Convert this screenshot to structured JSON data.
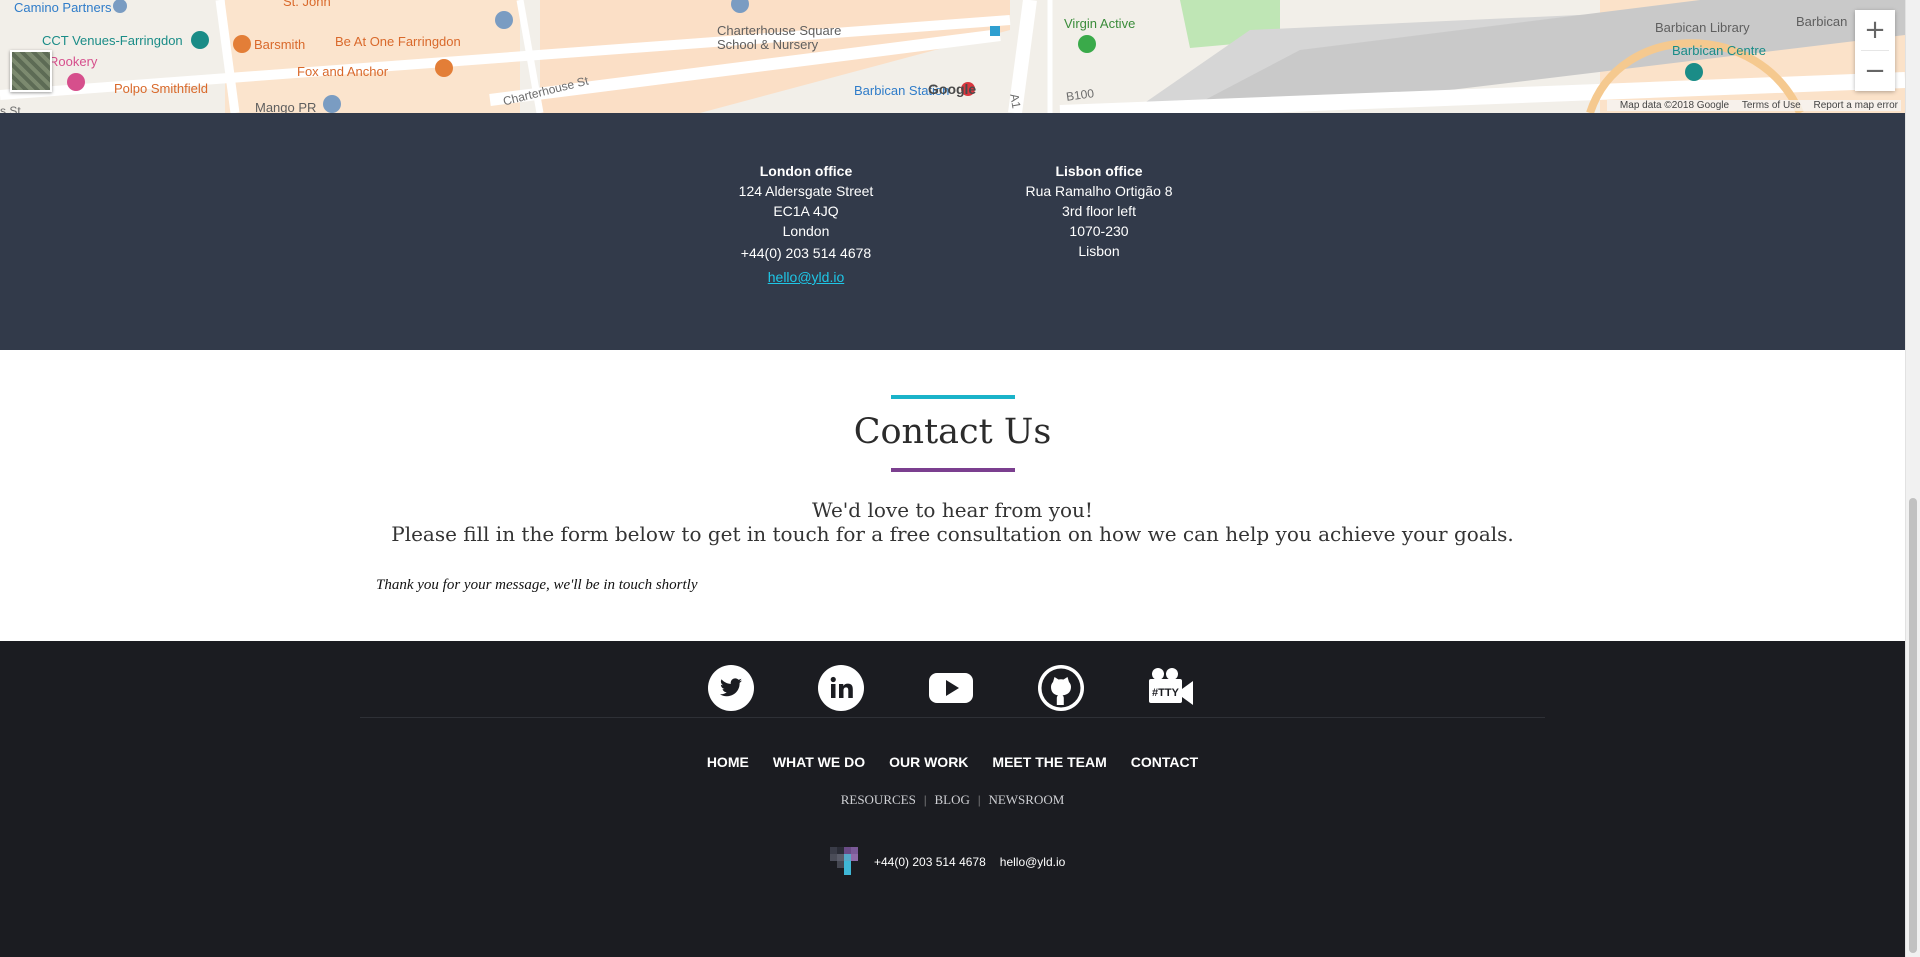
{
  "map": {
    "labels": {
      "camino": "Camino Partners",
      "cct": "CCT Venues-Farringdon",
      "rookery": "Rookery",
      "polpo": "Polpo Smithfield",
      "barsmith": "Barsmith",
      "beatone": "Be At One Farringdon",
      "foxanchor": "Fox and Anchor",
      "mango": "Mango PR",
      "stjohn": "St. John",
      "charterhouse_school": "Charterhouse Square\nSchool & Nursery",
      "charterhouse_st": "Charterhouse St",
      "barbican_station": "Barbican Station",
      "virgin": "Virgin Active",
      "barbican_library": "Barbican Library",
      "barbican_centre": "Barbican Centre",
      "barbican_edge": "Barbican",
      "b100": "B100",
      "a1": "A1",
      "st": "s St"
    },
    "google": "Google",
    "zoom_in": "+",
    "zoom_out": "−",
    "footer": {
      "data": "Map data ©2018 Google",
      "terms": "Terms of Use",
      "report": "Report a map error"
    }
  },
  "offices": {
    "london": {
      "title": "London office",
      "line1": "124 Aldersgate Street",
      "line2": "EC1A 4JQ",
      "line3": "London",
      "phone": "+44(0) 203 514 4678",
      "email": "hello@yld.io"
    },
    "lisbon": {
      "title": "Lisbon office",
      "line1": "Rua Ramalho Ortigão 8",
      "line2": "3rd floor left",
      "line3": "1070-230",
      "line4": "Lisbon"
    }
  },
  "contact": {
    "title": "Contact Us",
    "intro1": "We'd love to hear from you!",
    "intro2": "Please fill in the form below to get in touch for a free consultation on how we can help you achieve your goals.",
    "thanks": "Thank you for your message, we'll be in touch shortly",
    "colors": {
      "top_bar": "#1ab3c9",
      "bottom_bar": "#7b3f8f"
    }
  },
  "footer": {
    "socials": [
      "twitter-icon",
      "linkedin-icon",
      "youtube-icon",
      "github-icon",
      "tty-icon"
    ],
    "tty_label": "#TTY",
    "nav": [
      "HOME",
      "WHAT WE DO",
      "OUR WORK",
      "MEET THE TEAM",
      "CONTACT"
    ],
    "subnav": [
      "RESOURCES",
      "BLOG",
      "NEWSROOM"
    ],
    "phone": "+44(0) 203 514 4678",
    "email": "hello@yld.io"
  }
}
